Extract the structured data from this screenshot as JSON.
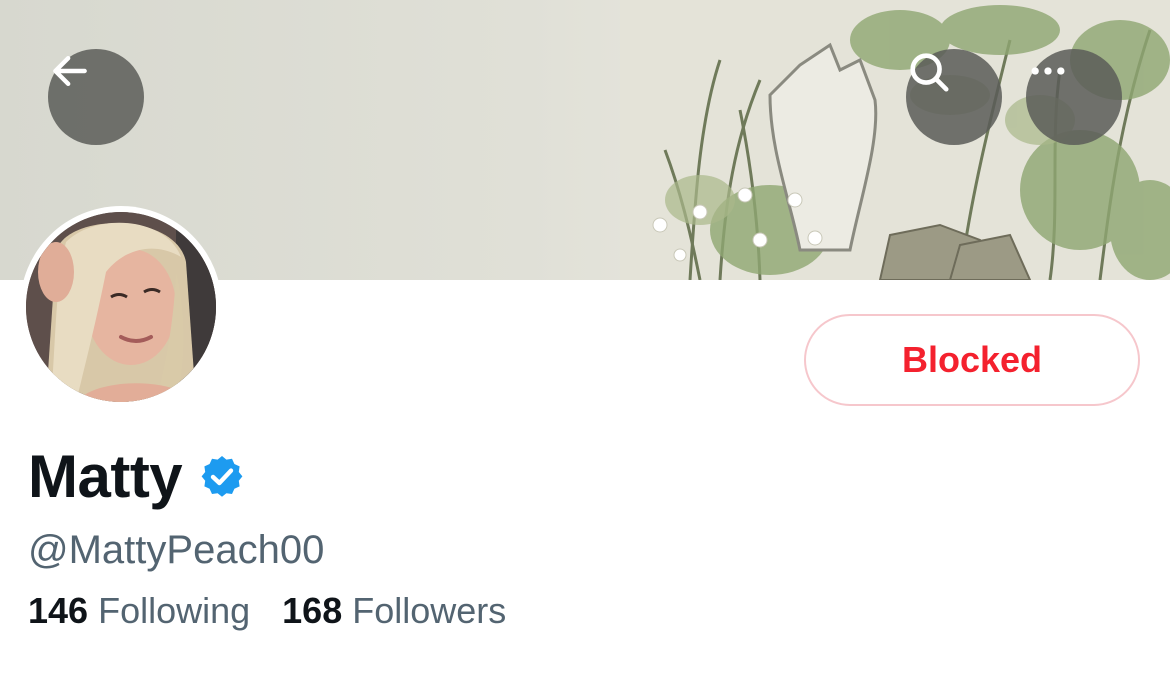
{
  "header": {
    "back_icon": "arrow-left-icon",
    "search_icon": "search-icon",
    "more_icon": "more-horizontal-icon"
  },
  "profile": {
    "display_name": "Matty",
    "verified_icon": "verified-badge-icon",
    "handle": "@MattyPeach00",
    "relationship_button": "Blocked",
    "following_count": "146",
    "following_label": "Following",
    "followers_count": "168",
    "followers_label": "Followers"
  },
  "colors": {
    "blocked_text": "#f4212e",
    "blocked_border": "#f6c7cc",
    "verified": "#1d9bf0",
    "secondary_text": "#536471",
    "primary_text": "#0f1419"
  }
}
